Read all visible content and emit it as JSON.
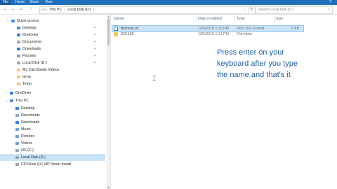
{
  "ribbon": {
    "tabs": [
      "File",
      "Home",
      "Share",
      "View"
    ]
  },
  "address": {
    "path": [
      "This PC",
      "Local Disk (D:)"
    ],
    "search_placeholder": "Search Local Disk (D:)"
  },
  "nav": {
    "items": [
      {
        "label": "Quick access",
        "icon": "star-icon",
        "color": "#3d8ee8"
      },
      {
        "label": "Desktop",
        "icon": "desktop-icon",
        "color": "#3a87d6",
        "pinned": true
      },
      {
        "label": "OneDrive",
        "icon": "cloud-icon",
        "color": "#2f7bd8",
        "pinned": true
      },
      {
        "label": "Documents",
        "icon": "documents-icon",
        "color": "#8fa6c0",
        "pinned": true
      },
      {
        "label": "Downloads",
        "icon": "download-icon",
        "color": "#2f7bd8",
        "pinned": true
      },
      {
        "label": "Pictures",
        "icon": "pictures-icon",
        "color": "#6fa0d6",
        "pinned": true
      },
      {
        "label": "Local Disk (D:)",
        "icon": "drive-icon",
        "color": "#9aa2aa",
        "pinned": true
      },
      {
        "label": "My CamStudio Videos",
        "icon": "folder-icon",
        "color": "#f2c75c"
      },
      {
        "label": "temp",
        "icon": "folder-icon",
        "color": "#f2c75c"
      },
      {
        "label": "Temp",
        "icon": "folder-icon",
        "color": "#f2c75c"
      },
      {
        "label": "OneDrive",
        "icon": "cloud-icon",
        "color": "#2f7bd8"
      },
      {
        "label": "This PC",
        "icon": "computer-icon",
        "color": "#4a8fd6"
      },
      {
        "label": "Desktop",
        "icon": "desktop-icon",
        "color": "#3a87d6"
      },
      {
        "label": "Documents",
        "icon": "documents-icon",
        "color": "#8fa6c0"
      },
      {
        "label": "Downloads",
        "icon": "download-icon",
        "color": "#2f7bd8"
      },
      {
        "label": "Music",
        "icon": "music-icon",
        "color": "#6fa0d6"
      },
      {
        "label": "Pictures",
        "icon": "pictures-icon",
        "color": "#6fa0d6"
      },
      {
        "label": "Videos",
        "icon": "videos-icon",
        "color": "#6fa0d6"
      },
      {
        "label": "OS (C:)",
        "icon": "drive-icon",
        "color": "#9aa2aa"
      },
      {
        "label": "Local Disk (D:)",
        "icon": "drive-icon",
        "color": "#9aa2aa",
        "selected": true
      },
      {
        "label": "CD Drive (H:) HP Smart Install",
        "icon": "cd-drive-icon",
        "color": "#9aa2aa"
      }
    ]
  },
  "columns": {
    "name": "Name",
    "date": "Date modified",
    "type": "Type",
    "size": "Size"
  },
  "files": [
    {
      "name": "Broncos.rtf",
      "date": "1/26/2018 1:32 PM",
      "type": "Rich Text Format",
      "size": "0 KB",
      "icon": "rtf-file-icon",
      "selected": true
    },
    {
      "name": "CIS 110",
      "date": "1/26/2018 1:31 PM",
      "type": "File folder",
      "size": "",
      "icon": "folder-icon"
    }
  ],
  "note": {
    "lines": [
      "Press enter on your",
      "keyboard after you type",
      "the name and that's it"
    ],
    "color": "#1f5fa6"
  }
}
